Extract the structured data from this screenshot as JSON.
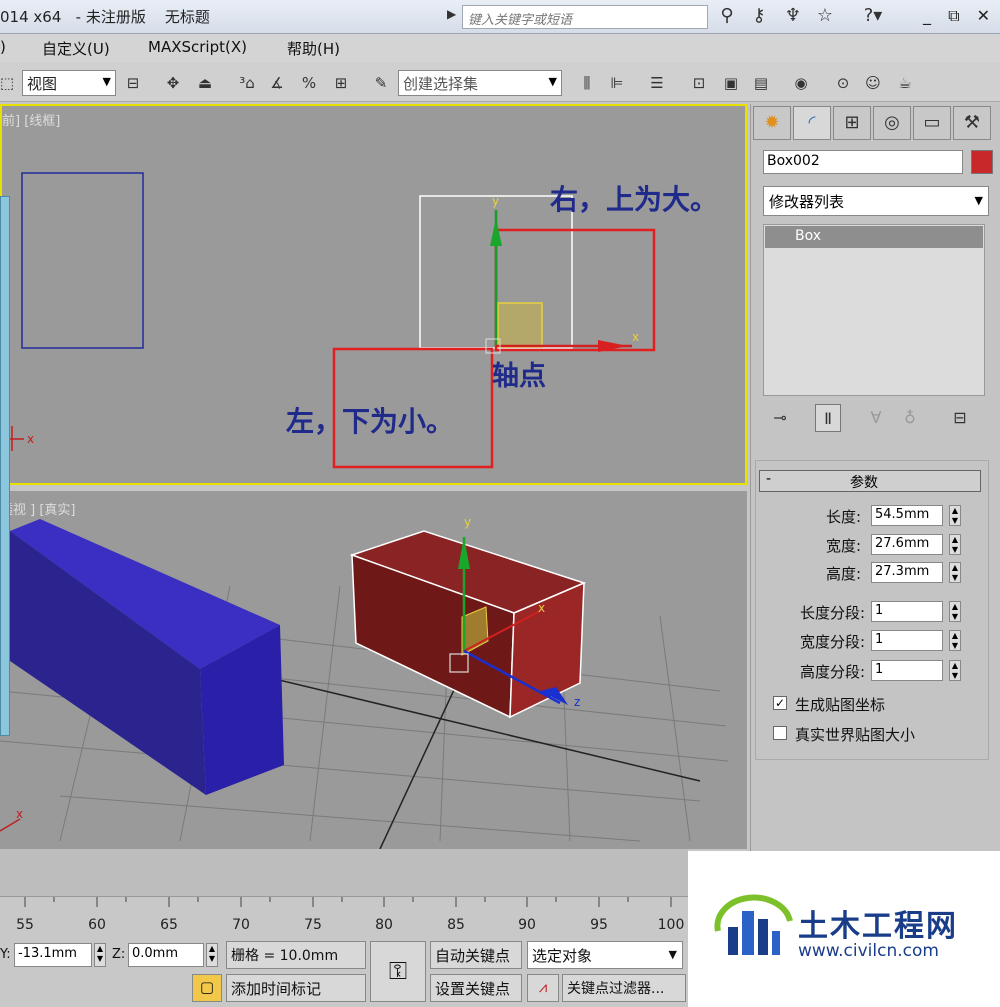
{
  "title_bar": {
    "title": "014 x64   - 未注册版    无标题",
    "search_placeholder": "键入关键字或短语",
    "icons": [
      "binoculars-icon",
      "key-icon",
      "antenna-icon",
      "star-icon",
      "help-icon"
    ],
    "help_glyph": "?",
    "window_controls": "_ ⧉ ✕"
  },
  "menu_bar": {
    "items": [
      ")",
      "自定义(U)",
      "MAXScript(X)",
      "帮助(H)"
    ]
  },
  "toolbar": {
    "view_combo": "视图",
    "selection_set_combo": "创建选择集"
  },
  "viewport_top": {
    "label": "前] [线框]",
    "annotation_right": "右，上为大。",
    "annotation_pivot": "轴点",
    "annotation_left": "左，下为小。",
    "axis_y": "y",
    "axis_x": "x",
    "axis_x_left": "x"
  },
  "viewport_persp": {
    "label": "透视 ] [真实]",
    "axis_y": "y",
    "axis_x": "x",
    "axis_z": "z",
    "axis_x_left": "x"
  },
  "command_panel": {
    "object_name": "Box002",
    "object_color": "#c8282a",
    "modifier_list": "修改器列表",
    "stack_item": "Box",
    "rollout_title": "参数",
    "rollout_toggle": "-",
    "params": {
      "length_label": "长度:",
      "length_value": "54.5mm",
      "width_label": "宽度:",
      "width_value": "27.6mm",
      "height_label": "高度:",
      "height_value": "27.3mm",
      "length_segs_label": "长度分段:",
      "length_segs_value": "1",
      "width_segs_label": "宽度分段:",
      "width_segs_value": "1",
      "height_segs_label": "高度分段:",
      "height_segs_value": "1"
    },
    "gen_mapping_label": "生成贴图坐标",
    "gen_mapping_checked": true,
    "real_world_label": "真实世界贴图大小",
    "real_world_checked": false
  },
  "timeline": {
    "ticks": [
      "55",
      "60",
      "65",
      "70",
      "75",
      "80",
      "85",
      "90",
      "95",
      "100"
    ]
  },
  "status_bar": {
    "y_label": "Y:",
    "y_value": "-13.1mm",
    "z_label": "Z:",
    "z_value": "0.0mm",
    "grid_text": "栅格 = 10.0mm",
    "add_time_tag": "添加时间标记",
    "auto_key": "自动关键点",
    "set_key": "设置关键点",
    "selected_object": "选定对象",
    "key_filters": "关键点过滤器..."
  },
  "watermark": {
    "name": "土木工程网",
    "url": "www.civilcn.com"
  }
}
